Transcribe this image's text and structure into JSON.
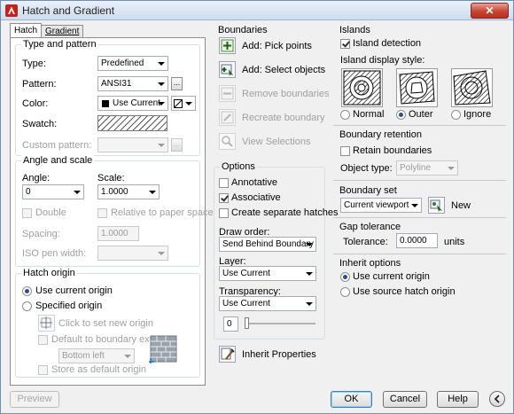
{
  "window": {
    "title": "Hatch and Gradient"
  },
  "tabs": [
    {
      "label": "Hatch"
    },
    {
      "label": "Gradient"
    }
  ],
  "type_and_pattern": {
    "title": "Type and pattern",
    "type_label": "Type:",
    "type_value": "Predefined",
    "pattern_label": "Pattern:",
    "pattern_value": "ANSI31",
    "color_label": "Color:",
    "color_value": "Use Current",
    "swatch_label": "Swatch:",
    "custom_pattern_label": "Custom pattern:",
    "custom_pattern_value": "",
    "browse_label": "..."
  },
  "angle_and_scale": {
    "title": "Angle and scale",
    "angle_label": "Angle:",
    "angle_value": "0",
    "scale_label": "Scale:",
    "scale_value": "1.0000",
    "double_label": "Double",
    "relative_label": "Relative to paper space",
    "spacing_label": "Spacing:",
    "spacing_value": "1.0000",
    "iso_label": "ISO pen width:",
    "iso_value": ""
  },
  "hatch_origin": {
    "title": "Hatch origin",
    "use_current_label": "Use current origin",
    "specified_label": "Specified origin",
    "click_set_label": "Click to set new origin",
    "default_boundary_label": "Default to boundary extents",
    "boundary_position_value": "Bottom left",
    "store_default_label": "Store as default origin"
  },
  "boundaries": {
    "title": "Boundaries",
    "add_pick_label": "Add: Pick points",
    "add_select_label": "Add: Select objects",
    "remove_label": "Remove boundaries",
    "recreate_label": "Recreate boundary",
    "view_label": "View Selections"
  },
  "options": {
    "title": "Options",
    "annotative_label": "Annotative",
    "associative_label": "Associative",
    "separate_label": "Create separate hatches",
    "draw_order_label": "Draw order:",
    "draw_order_value": "Send Behind Boundary",
    "layer_label": "Layer:",
    "layer_value": "Use Current",
    "transparency_label": "Transparency:",
    "transparency_value": "Use Current",
    "transparency_amount": "0",
    "transparency_level": 0
  },
  "inherit_properties_label": "Inherit Properties",
  "islands": {
    "title": "Islands",
    "island_detection_label": "Island detection",
    "display_style_label": "Island display style:",
    "normal_label": "Normal",
    "outer_label": "Outer",
    "ignore_label": "Ignore"
  },
  "boundary_retention": {
    "title": "Boundary retention",
    "retain_label": "Retain boundaries",
    "object_type_label": "Object type:",
    "object_type_value": "Polyline"
  },
  "boundary_set": {
    "title": "Boundary set",
    "value": "Current viewport",
    "new_label": "New"
  },
  "gap_tolerance": {
    "title": "Gap tolerance",
    "tolerance_label": "Tolerance:",
    "tolerance_value": "0.0000",
    "units_label": "units"
  },
  "inherit_options": {
    "title": "Inherit options",
    "use_current_label": "Use current origin",
    "use_source_label": "Use source hatch origin"
  },
  "footer": {
    "preview_label": "Preview",
    "ok_label": "OK",
    "cancel_label": "Cancel",
    "help_label": "Help",
    "more_icon": "chevron-left-icon"
  }
}
